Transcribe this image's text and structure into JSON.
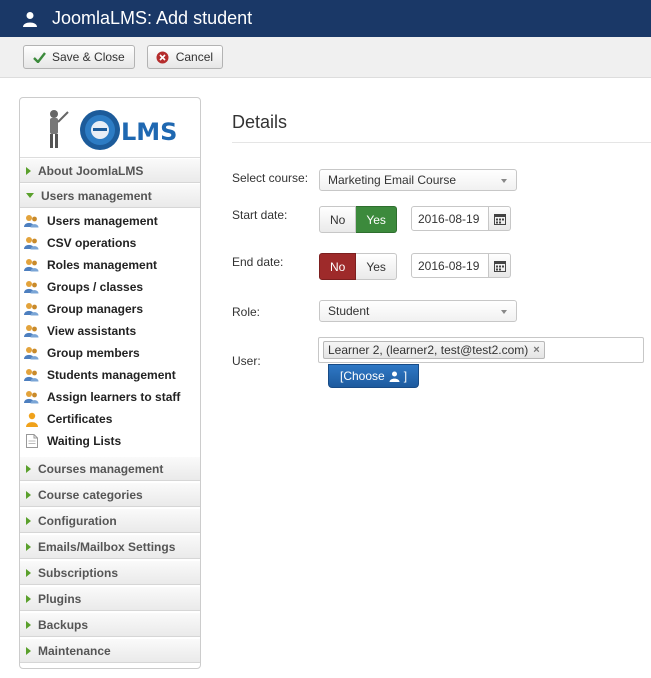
{
  "header": {
    "title": "JoomlaLMS: Add student"
  },
  "toolbar": {
    "save_label": "Save & Close",
    "cancel_label": "Cancel"
  },
  "sidebar": {
    "logo_text": "LMS",
    "sections": [
      {
        "label": "About JoomlaLMS",
        "expanded": false
      },
      {
        "label": "Users management",
        "expanded": true,
        "items": [
          {
            "label": "Users management",
            "icon": "users-icon"
          },
          {
            "label": "CSV operations",
            "icon": "users-icon"
          },
          {
            "label": "Roles management",
            "icon": "users-icon"
          },
          {
            "label": "Groups / classes",
            "icon": "users-icon"
          },
          {
            "label": "Group managers",
            "icon": "users-icon"
          },
          {
            "label": "View assistants",
            "icon": "users-icon"
          },
          {
            "label": "Group members",
            "icon": "users-icon"
          },
          {
            "label": "Students management",
            "icon": "users-icon"
          },
          {
            "label": "Assign learners to staff",
            "icon": "users-icon"
          },
          {
            "label": "Certificates",
            "icon": "certificate-icon"
          },
          {
            "label": "Waiting Lists",
            "icon": "document-icon"
          }
        ]
      },
      {
        "label": "Courses management",
        "expanded": false
      },
      {
        "label": "Course categories",
        "expanded": false
      },
      {
        "label": "Configuration",
        "expanded": false
      },
      {
        "label": "Emails/Mailbox Settings",
        "expanded": false
      },
      {
        "label": "Subscriptions",
        "expanded": false
      },
      {
        "label": "Plugins",
        "expanded": false
      },
      {
        "label": "Backups",
        "expanded": false
      },
      {
        "label": "Maintenance",
        "expanded": false
      }
    ]
  },
  "main": {
    "heading": "Details",
    "fields": {
      "course": {
        "label": "Select course:",
        "value": "Marketing Email Course"
      },
      "start_date": {
        "label": "Start date:",
        "no": "No",
        "yes": "Yes",
        "selected": "Yes",
        "value": "2016-08-19"
      },
      "end_date": {
        "label": "End date:",
        "no": "No",
        "yes": "Yes",
        "selected": "No",
        "value": "2016-08-19"
      },
      "role": {
        "label": "Role:",
        "value": "Student"
      },
      "user": {
        "label": "User:",
        "chip": "Learner 2, (learner2, test@test2.com)",
        "remove": "×",
        "choose_label": "[Choose",
        "choose_suffix": "]"
      }
    }
  },
  "colors": {
    "header_bg": "#1a3867",
    "yes_green": "#3c8a3c",
    "no_red": "#9e2a2a",
    "choose_blue": "#2f78c5",
    "accordion_arrow": "#5aa02c"
  }
}
